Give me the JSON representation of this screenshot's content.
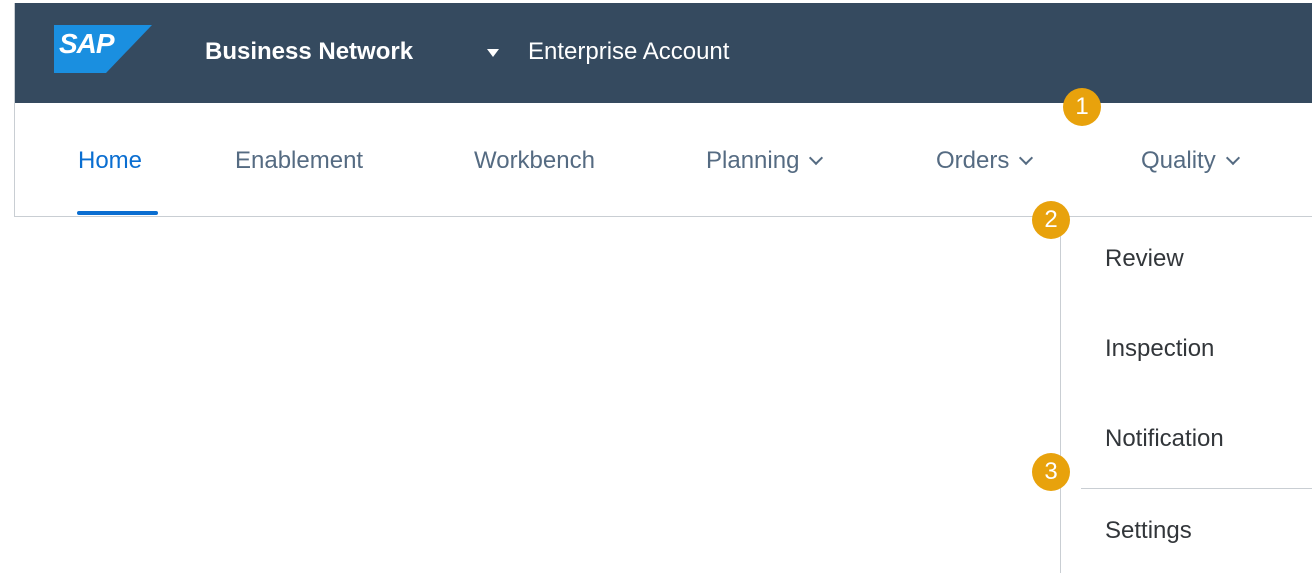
{
  "colors": {
    "shellbar": "#354a5f",
    "active_tab": "#0a6ed1",
    "tab_text": "#556b82",
    "step_marker": "#e8a20c"
  },
  "shellbar": {
    "logo_text": "SAP",
    "product": "Business Network",
    "product_dropdown_icon": "caret-down-icon",
    "account": "Enterprise Account"
  },
  "tabs": [
    {
      "label": "Home",
      "active": true
    },
    {
      "label": "Enablement"
    },
    {
      "label": "Workbench"
    },
    {
      "label": "Planning",
      "icon": "chevron-down-icon"
    },
    {
      "label": "Orders",
      "icon": "chevron-down-icon"
    },
    {
      "label": "Quality",
      "icon": "chevron-down-icon"
    }
  ],
  "quality_menu": {
    "items": [
      "Review",
      "Inspection",
      "Notification",
      "Settings"
    ]
  },
  "step_markers": [
    "1",
    "2",
    "3"
  ]
}
